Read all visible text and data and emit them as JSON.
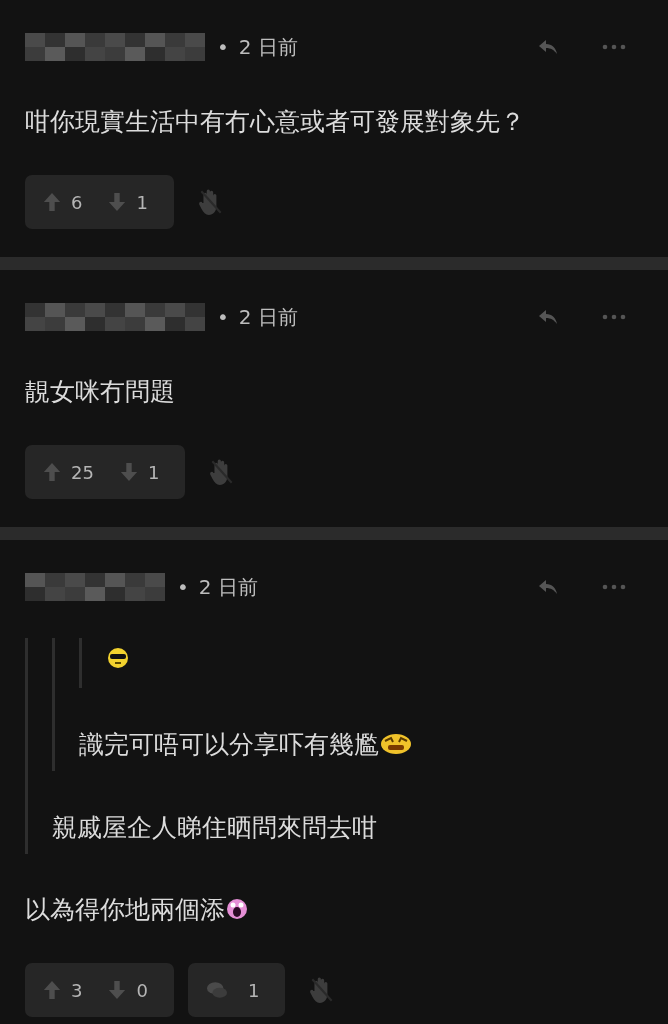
{
  "posts": [
    {
      "bullet": "•",
      "time": "2 日前",
      "content": [
        {
          "kind": "text",
          "text": "咁你現實生活中有冇心意或者可發展對象先？"
        }
      ],
      "votes": {
        "up": "6",
        "down": "1"
      }
    },
    {
      "bullet": "•",
      "time": "2 日前",
      "content": [
        {
          "kind": "text",
          "text": "靚女咪冇問題"
        }
      ],
      "votes": {
        "up": "25",
        "down": "1"
      }
    },
    {
      "bullet": "•",
      "time": "2 日前",
      "quote": {
        "quote": {
          "quote": {
            "content": [
              {
                "kind": "sunglasses"
              }
            ]
          },
          "content": [
            {
              "kind": "text",
              "text": "識完可唔可以分享吓有幾尷"
            },
            {
              "kind": "awkward"
            }
          ]
        },
        "content": [
          {
            "kind": "text",
            "text": "親戚屋企人睇住晒問來問去咁"
          }
        ]
      },
      "content": [
        {
          "kind": "text",
          "text": "以為得你地兩個添"
        },
        {
          "kind": "shocked"
        }
      ],
      "votes": {
        "up": "3",
        "down": "0"
      },
      "replies": "1"
    }
  ]
}
